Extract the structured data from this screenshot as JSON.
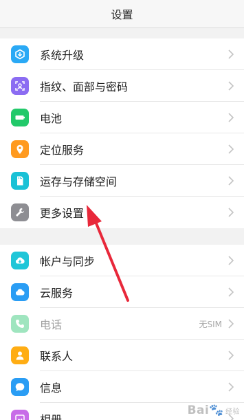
{
  "header": {
    "title": "设置"
  },
  "groups": [
    {
      "items": [
        {
          "label": "系统升级",
          "icon": "system-update-icon",
          "color": "#2aa9f5"
        },
        {
          "label": "指纹、面部与密码",
          "icon": "fingerprint-face-icon",
          "color": "#8b6cf2"
        },
        {
          "label": "电池",
          "icon": "battery-icon",
          "color": "#22c96a"
        },
        {
          "label": "定位服务",
          "icon": "location-pin-icon",
          "color": "#ff9a1f"
        },
        {
          "label": "运存与存储空间",
          "icon": "storage-card-icon",
          "color": "#19c1d6"
        },
        {
          "label": "更多设置",
          "icon": "wrench-icon",
          "color": "#8e8e93"
        }
      ]
    },
    {
      "items": [
        {
          "label": "帐户与同步",
          "icon": "cloud-sync-icon",
          "color": "#1fc6d8"
        },
        {
          "label": "云服务",
          "icon": "cloud-icon",
          "color": "#2a9df4"
        },
        {
          "label": "电话",
          "value": "无SIM",
          "icon": "phone-icon",
          "color": "#9fe5bf",
          "disabled": true
        },
        {
          "label": "联系人",
          "icon": "contact-icon",
          "color": "#ffad14"
        },
        {
          "label": "信息",
          "icon": "message-icon",
          "color": "#2a9df4"
        },
        {
          "label": "相册",
          "icon": "gallery-icon",
          "color": "#c86de8"
        }
      ]
    }
  ],
  "watermark": {
    "brand": "Bai",
    "suffix": "经验"
  }
}
